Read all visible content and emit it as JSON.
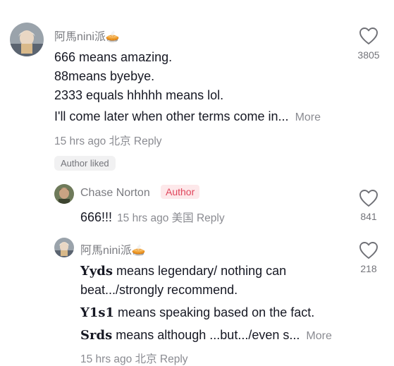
{
  "comments": [
    {
      "username": "阿馬nini派🥧",
      "lines": [
        "666 means amazing.",
        "88means byebye.",
        "2333 equals hhhhh means lol.",
        "I'll come later when other terms come in..."
      ],
      "more": "More",
      "time": "15 hrs ago",
      "location": "北京",
      "reply": "Reply",
      "author_liked": "Author liked",
      "likes": "3805"
    }
  ],
  "replies": [
    {
      "username": "Chase Norton",
      "badge": "Author",
      "text": "666!!!",
      "time": "15 hrs ago",
      "location": "美国",
      "reply": "Reply",
      "likes": "841"
    },
    {
      "username": "阿馬nini派🥧",
      "para1_bold": "Yyds",
      "para1_rest": " means legendary/ nothing can",
      "para1_line2": "beat.../strongly recommend.",
      "para2_bold": "Y1s1",
      "para2_rest": " means speaking based on the fact.",
      "para3_bold": "Srds",
      "para3_rest": " means although ...but.../even s...",
      "more": "More",
      "time": "15 hrs ago",
      "location": "北京",
      "reply": "Reply",
      "likes": "218"
    }
  ],
  "colors": {
    "text": "#161823",
    "muted": "#8a8b91",
    "author_badge": "#e0465c"
  }
}
